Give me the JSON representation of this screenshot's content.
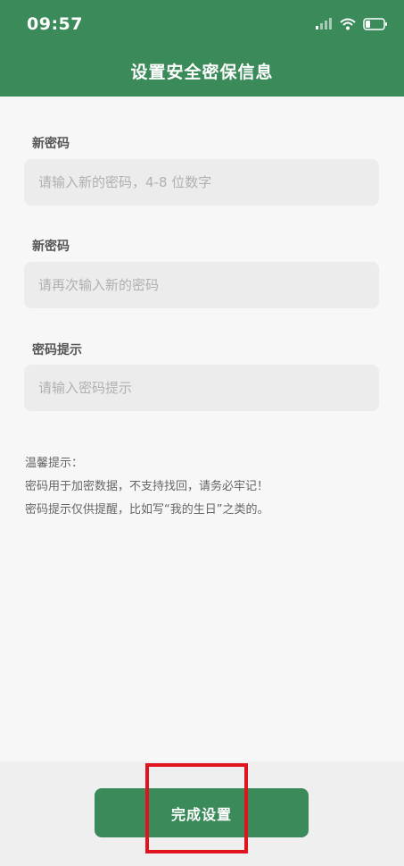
{
  "status_bar": {
    "time": "09:57",
    "icons": [
      "signal-icon",
      "wifi-icon",
      "battery-icon"
    ]
  },
  "header": {
    "title": "设置安全密保信息",
    "color": "#3b8a5a"
  },
  "form": {
    "new_password": {
      "label": "新密码",
      "placeholder": "请输入新的密码，4-8 位数字"
    },
    "confirm_password": {
      "label": "新密码",
      "placeholder": "请再次输入新的密码"
    },
    "hint": {
      "label": "密码提示",
      "placeholder": "请输入密码提示"
    }
  },
  "tips": {
    "title": "温馨提示：",
    "line1": "密码用于加密数据，不支持找回，请务必牢记！",
    "line2": "密码提示仅供提醒，比如写“我的生日”之类的。"
  },
  "footer": {
    "submit_label": "完成设置",
    "highlight_color": "#e0141e"
  }
}
